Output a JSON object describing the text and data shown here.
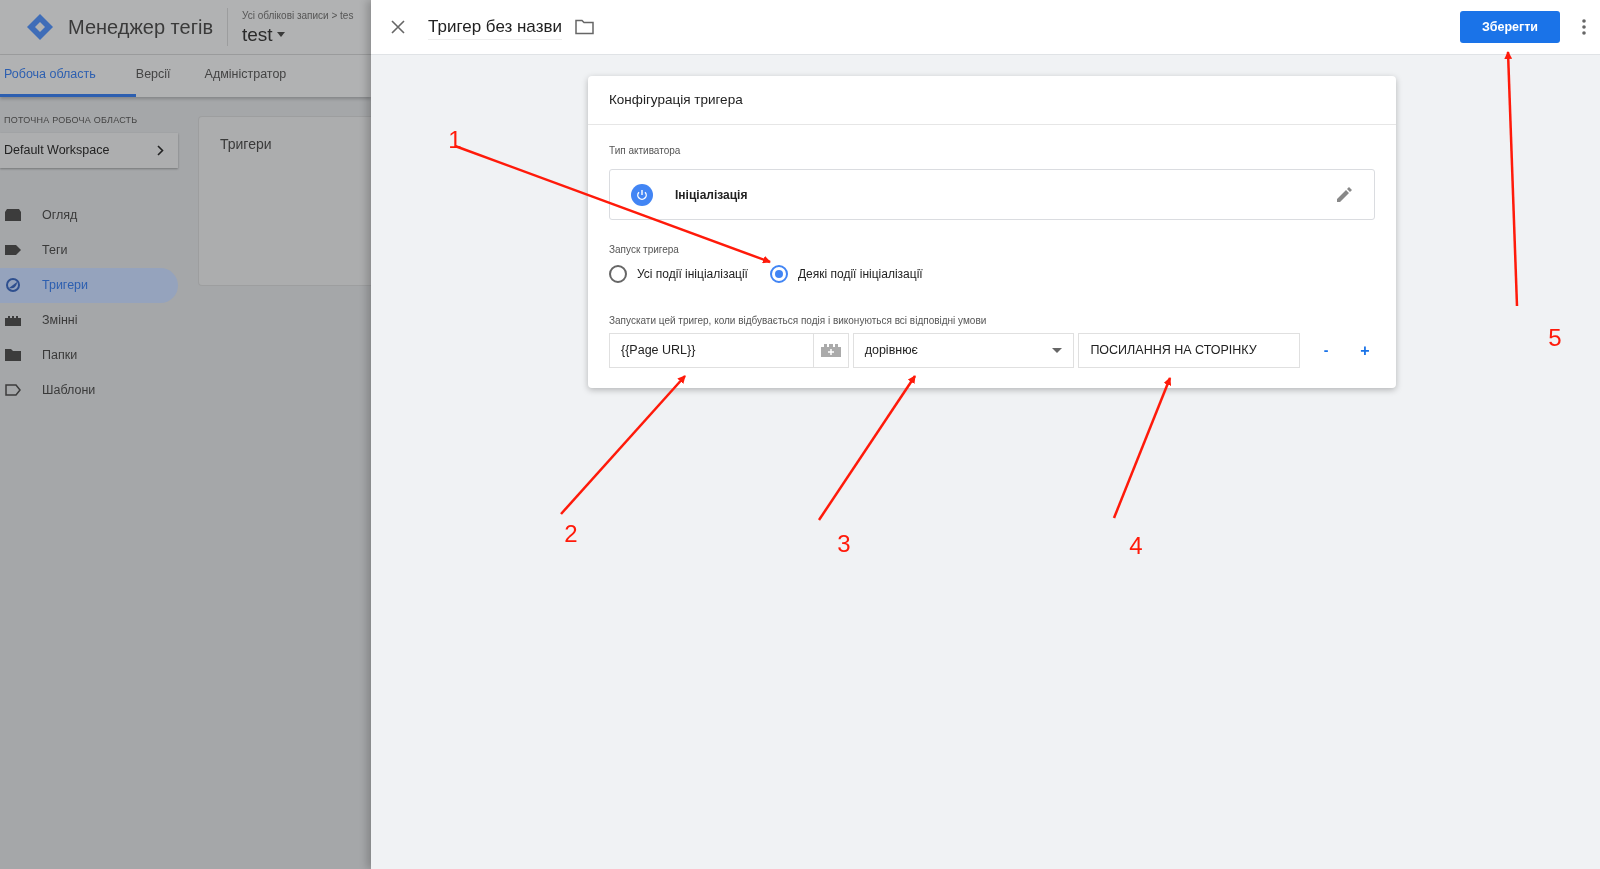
{
  "background_app": {
    "product": "Менеджер тегів",
    "breadcrumb": "Усі облікові записи > tes",
    "container": "test",
    "tabs": [
      {
        "label": "Робоча область",
        "selected": true
      },
      {
        "label": "Версії",
        "selected": false
      },
      {
        "label": "Адміністратор",
        "selected": false
      }
    ],
    "workspace_heading": "ПОТОЧНА РОБОЧА ОБЛАСТЬ",
    "workspace": "Default Workspace",
    "nav": [
      {
        "label": "Огляд",
        "selected": false
      },
      {
        "label": "Теги",
        "selected": false
      },
      {
        "label": "Тригери",
        "selected": true
      },
      {
        "label": "Змінні",
        "selected": false
      },
      {
        "label": "Папки",
        "selected": false
      },
      {
        "label": "Шаблони",
        "selected": false
      }
    ],
    "card_title": "Тригери"
  },
  "editor": {
    "title": "Тригер без назви",
    "save": "Зберегти",
    "card": {
      "title": "Конфігурація тригера",
      "type_label": "Тип активатора",
      "type": "Ініціалізація",
      "fire_label": "Запуск тригера",
      "fire_options": [
        {
          "label": "Усі події ініціалізації",
          "selected": false
        },
        {
          "label": "Деякі події ініціалізації",
          "selected": true
        }
      ],
      "condition_label": "Запускати цей тригер, коли відбувається подія і виконуються всі відповідні умови",
      "condition": {
        "variable": "{{Page URL}}",
        "operator": "дорівнює",
        "value": "ПОСИЛАННЯ НА СТОРІНКУ",
        "remove": "-",
        "add": "+"
      }
    }
  },
  "annotations": [
    "1",
    "2",
    "3",
    "4",
    "5"
  ]
}
